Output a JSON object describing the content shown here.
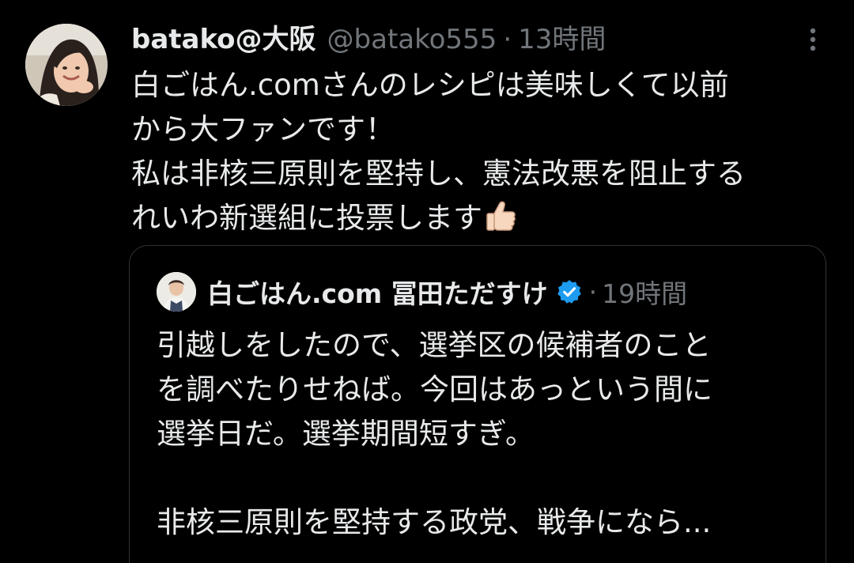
{
  "tweet": {
    "author": {
      "display_name": "batako@大阪",
      "handle": "@batako555",
      "timestamp": "13時間"
    },
    "separator": "·",
    "text_lines": [
      "白ごはん.comさんのレシピは美味しくて以前",
      "から大ファンです！",
      "私は非核三原則を堅持し、憲法改悪を阻止する",
      "れいわ新選組に投票します"
    ],
    "emoji": "thumbs-up-icon"
  },
  "quote": {
    "author": {
      "display_name": "白ごはん.com 冨田ただすけ",
      "verified": true,
      "timestamp": "19時間"
    },
    "separator": "·",
    "text_lines": [
      "引越しをしたので、選挙区の候補者のこと",
      "を調べたりせねば。今回はあっという間に",
      "選挙日だ。選挙期間短すぎ。",
      "",
      "非核三原則を堅持する政党、戦争になら..."
    ]
  },
  "colors": {
    "background": "#000000",
    "primary_text": "#e7e9ea",
    "secondary_text": "#71767b",
    "border": "#2f3336",
    "verified_blue": "#1d9bf0"
  }
}
